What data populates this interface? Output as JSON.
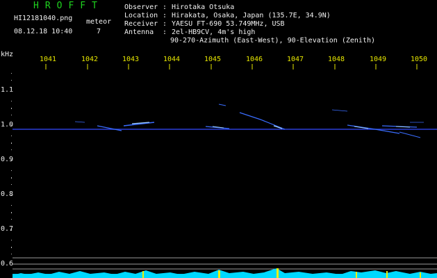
{
  "header": {
    "app_title": "HROFFT",
    "filename": "HI12181040.png",
    "datetime": "08.12.18 10:40",
    "meteor_label": "meteor",
    "meteor_count": "7"
  },
  "info": {
    "observer_label": "Observer",
    "observer_value": "Hirotaka Otsuka",
    "location_label": "Location",
    "location_value": "Hirakata, Osaka, Japan (135.7E, 34.9N)",
    "receiver_label": "Receiver",
    "receiver_value": "YAESU FT-690 53.749MHz, USB",
    "antenna_label": "Antenna",
    "antenna_value": "2el-HB9CV, 4m's high",
    "antenna_value2": "90-270-Azimuth (East-West), 90-Elevation (Zenith)"
  },
  "axis": {
    "y_unit": "kHz",
    "x_ticks": [
      "1041",
      "1042",
      "1043",
      "1044",
      "1045",
      "1046",
      "1047",
      "1048",
      "1049",
      "1050"
    ],
    "y_ticks": [
      "1.1",
      "1.0",
      "0.9",
      "0.8",
      "0.7",
      "0.6"
    ]
  },
  "colors": {
    "background": "#000000",
    "title": "#1fd51f",
    "ticks": "#e8e800",
    "signal": "#2e5cff",
    "noise": "#00d8ff",
    "baseline": "#aaaaaa"
  }
}
